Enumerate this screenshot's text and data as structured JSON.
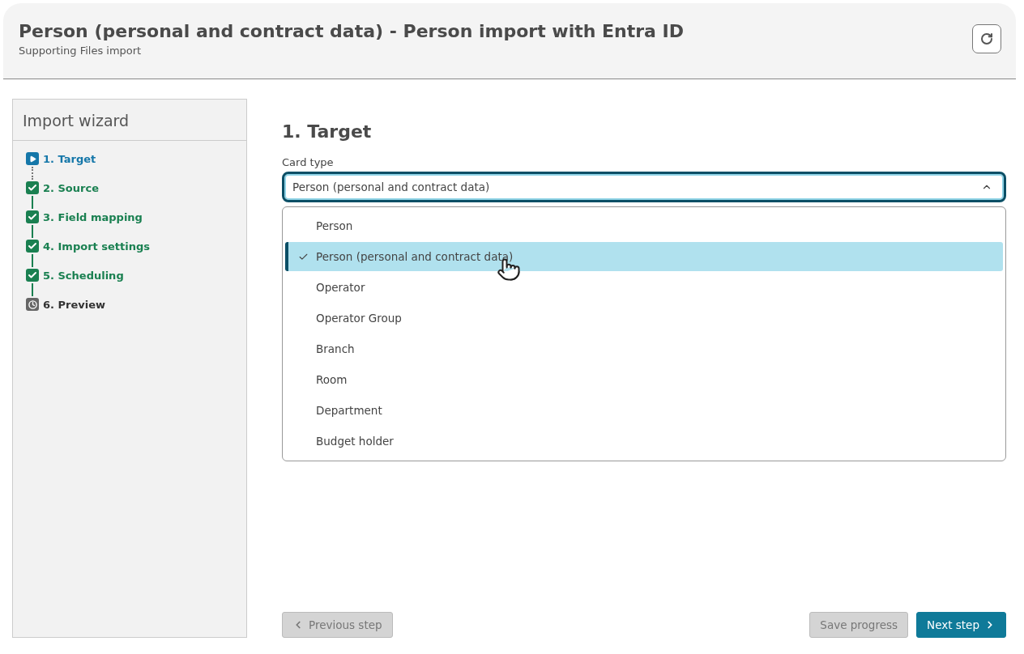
{
  "header": {
    "title": "Person (personal and contract data) - Person import with Entra ID",
    "subtitle": "Supporting Files import"
  },
  "sidebar": {
    "title": "Import wizard",
    "steps": [
      {
        "label": "1. Target",
        "kind": "current"
      },
      {
        "label": "2. Source",
        "kind": "done"
      },
      {
        "label": "3. Field mapping",
        "kind": "done"
      },
      {
        "label": "4. Import settings",
        "kind": "done"
      },
      {
        "label": "5. Scheduling",
        "kind": "done"
      },
      {
        "label": "6. Preview",
        "kind": "pending"
      }
    ]
  },
  "main": {
    "heading": "1. Target",
    "field_label": "Card type",
    "value": "Person (personal and contract data)",
    "expanded": true,
    "options": [
      {
        "label": "Person",
        "selected": false
      },
      {
        "label": "Person (personal and contract data)",
        "selected": true
      },
      {
        "label": "Operator",
        "selected": false
      },
      {
        "label": "Operator Group",
        "selected": false
      },
      {
        "label": "Branch",
        "selected": false
      },
      {
        "label": "Room",
        "selected": false
      },
      {
        "label": "Department",
        "selected": false
      },
      {
        "label": "Budget holder",
        "selected": false
      }
    ]
  },
  "footer": {
    "buttons": [
      {
        "label": "Previous step",
        "kind": "prev",
        "disabled": true
      },
      {
        "label": "Save progress",
        "kind": "save",
        "disabled": true
      },
      {
        "label": "Next step",
        "kind": "next",
        "disabled": false
      }
    ]
  }
}
